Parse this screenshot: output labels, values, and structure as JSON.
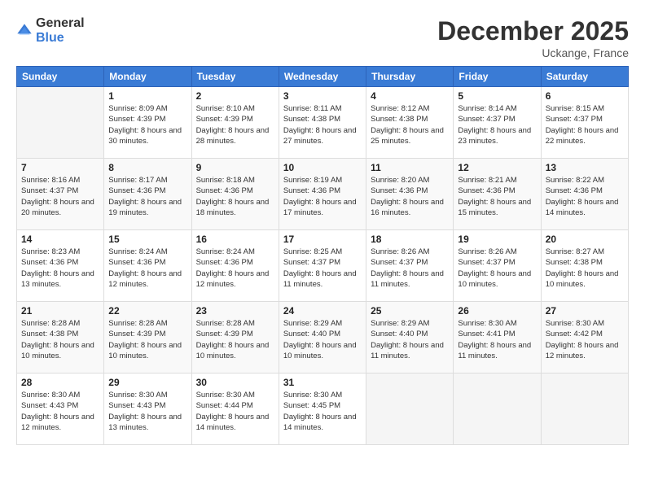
{
  "header": {
    "logo": {
      "general": "General",
      "blue": "Blue"
    },
    "title": "December 2025",
    "location": "Uckange, France"
  },
  "days_of_week": [
    "Sunday",
    "Monday",
    "Tuesday",
    "Wednesday",
    "Thursday",
    "Friday",
    "Saturday"
  ],
  "weeks": [
    [
      {
        "day": "",
        "sunrise": "",
        "sunset": "",
        "daylight": ""
      },
      {
        "day": "1",
        "sunrise": "Sunrise: 8:09 AM",
        "sunset": "Sunset: 4:39 PM",
        "daylight": "Daylight: 8 hours and 30 minutes."
      },
      {
        "day": "2",
        "sunrise": "Sunrise: 8:10 AM",
        "sunset": "Sunset: 4:39 PM",
        "daylight": "Daylight: 8 hours and 28 minutes."
      },
      {
        "day": "3",
        "sunrise": "Sunrise: 8:11 AM",
        "sunset": "Sunset: 4:38 PM",
        "daylight": "Daylight: 8 hours and 27 minutes."
      },
      {
        "day": "4",
        "sunrise": "Sunrise: 8:12 AM",
        "sunset": "Sunset: 4:38 PM",
        "daylight": "Daylight: 8 hours and 25 minutes."
      },
      {
        "day": "5",
        "sunrise": "Sunrise: 8:14 AM",
        "sunset": "Sunset: 4:37 PM",
        "daylight": "Daylight: 8 hours and 23 minutes."
      },
      {
        "day": "6",
        "sunrise": "Sunrise: 8:15 AM",
        "sunset": "Sunset: 4:37 PM",
        "daylight": "Daylight: 8 hours and 22 minutes."
      }
    ],
    [
      {
        "day": "7",
        "sunrise": "Sunrise: 8:16 AM",
        "sunset": "Sunset: 4:37 PM",
        "daylight": "Daylight: 8 hours and 20 minutes."
      },
      {
        "day": "8",
        "sunrise": "Sunrise: 8:17 AM",
        "sunset": "Sunset: 4:36 PM",
        "daylight": "Daylight: 8 hours and 19 minutes."
      },
      {
        "day": "9",
        "sunrise": "Sunrise: 8:18 AM",
        "sunset": "Sunset: 4:36 PM",
        "daylight": "Daylight: 8 hours and 18 minutes."
      },
      {
        "day": "10",
        "sunrise": "Sunrise: 8:19 AM",
        "sunset": "Sunset: 4:36 PM",
        "daylight": "Daylight: 8 hours and 17 minutes."
      },
      {
        "day": "11",
        "sunrise": "Sunrise: 8:20 AM",
        "sunset": "Sunset: 4:36 PM",
        "daylight": "Daylight: 8 hours and 16 minutes."
      },
      {
        "day": "12",
        "sunrise": "Sunrise: 8:21 AM",
        "sunset": "Sunset: 4:36 PM",
        "daylight": "Daylight: 8 hours and 15 minutes."
      },
      {
        "day": "13",
        "sunrise": "Sunrise: 8:22 AM",
        "sunset": "Sunset: 4:36 PM",
        "daylight": "Daylight: 8 hours and 14 minutes."
      }
    ],
    [
      {
        "day": "14",
        "sunrise": "Sunrise: 8:23 AM",
        "sunset": "Sunset: 4:36 PM",
        "daylight": "Daylight: 8 hours and 13 minutes."
      },
      {
        "day": "15",
        "sunrise": "Sunrise: 8:24 AM",
        "sunset": "Sunset: 4:36 PM",
        "daylight": "Daylight: 8 hours and 12 minutes."
      },
      {
        "day": "16",
        "sunrise": "Sunrise: 8:24 AM",
        "sunset": "Sunset: 4:36 PM",
        "daylight": "Daylight: 8 hours and 12 minutes."
      },
      {
        "day": "17",
        "sunrise": "Sunrise: 8:25 AM",
        "sunset": "Sunset: 4:37 PM",
        "daylight": "Daylight: 8 hours and 11 minutes."
      },
      {
        "day": "18",
        "sunrise": "Sunrise: 8:26 AM",
        "sunset": "Sunset: 4:37 PM",
        "daylight": "Daylight: 8 hours and 11 minutes."
      },
      {
        "day": "19",
        "sunrise": "Sunrise: 8:26 AM",
        "sunset": "Sunset: 4:37 PM",
        "daylight": "Daylight: 8 hours and 10 minutes."
      },
      {
        "day": "20",
        "sunrise": "Sunrise: 8:27 AM",
        "sunset": "Sunset: 4:38 PM",
        "daylight": "Daylight: 8 hours and 10 minutes."
      }
    ],
    [
      {
        "day": "21",
        "sunrise": "Sunrise: 8:28 AM",
        "sunset": "Sunset: 4:38 PM",
        "daylight": "Daylight: 8 hours and 10 minutes."
      },
      {
        "day": "22",
        "sunrise": "Sunrise: 8:28 AM",
        "sunset": "Sunset: 4:39 PM",
        "daylight": "Daylight: 8 hours and 10 minutes."
      },
      {
        "day": "23",
        "sunrise": "Sunrise: 8:28 AM",
        "sunset": "Sunset: 4:39 PM",
        "daylight": "Daylight: 8 hours and 10 minutes."
      },
      {
        "day": "24",
        "sunrise": "Sunrise: 8:29 AM",
        "sunset": "Sunset: 4:40 PM",
        "daylight": "Daylight: 8 hours and 10 minutes."
      },
      {
        "day": "25",
        "sunrise": "Sunrise: 8:29 AM",
        "sunset": "Sunset: 4:40 PM",
        "daylight": "Daylight: 8 hours and 11 minutes."
      },
      {
        "day": "26",
        "sunrise": "Sunrise: 8:30 AM",
        "sunset": "Sunset: 4:41 PM",
        "daylight": "Daylight: 8 hours and 11 minutes."
      },
      {
        "day": "27",
        "sunrise": "Sunrise: 8:30 AM",
        "sunset": "Sunset: 4:42 PM",
        "daylight": "Daylight: 8 hours and 12 minutes."
      }
    ],
    [
      {
        "day": "28",
        "sunrise": "Sunrise: 8:30 AM",
        "sunset": "Sunset: 4:43 PM",
        "daylight": "Daylight: 8 hours and 12 minutes."
      },
      {
        "day": "29",
        "sunrise": "Sunrise: 8:30 AM",
        "sunset": "Sunset: 4:43 PM",
        "daylight": "Daylight: 8 hours and 13 minutes."
      },
      {
        "day": "30",
        "sunrise": "Sunrise: 8:30 AM",
        "sunset": "Sunset: 4:44 PM",
        "daylight": "Daylight: 8 hours and 14 minutes."
      },
      {
        "day": "31",
        "sunrise": "Sunrise: 8:30 AM",
        "sunset": "Sunset: 4:45 PM",
        "daylight": "Daylight: 8 hours and 14 minutes."
      },
      {
        "day": "",
        "sunrise": "",
        "sunset": "",
        "daylight": ""
      },
      {
        "day": "",
        "sunrise": "",
        "sunset": "",
        "daylight": ""
      },
      {
        "day": "",
        "sunrise": "",
        "sunset": "",
        "daylight": ""
      }
    ]
  ]
}
